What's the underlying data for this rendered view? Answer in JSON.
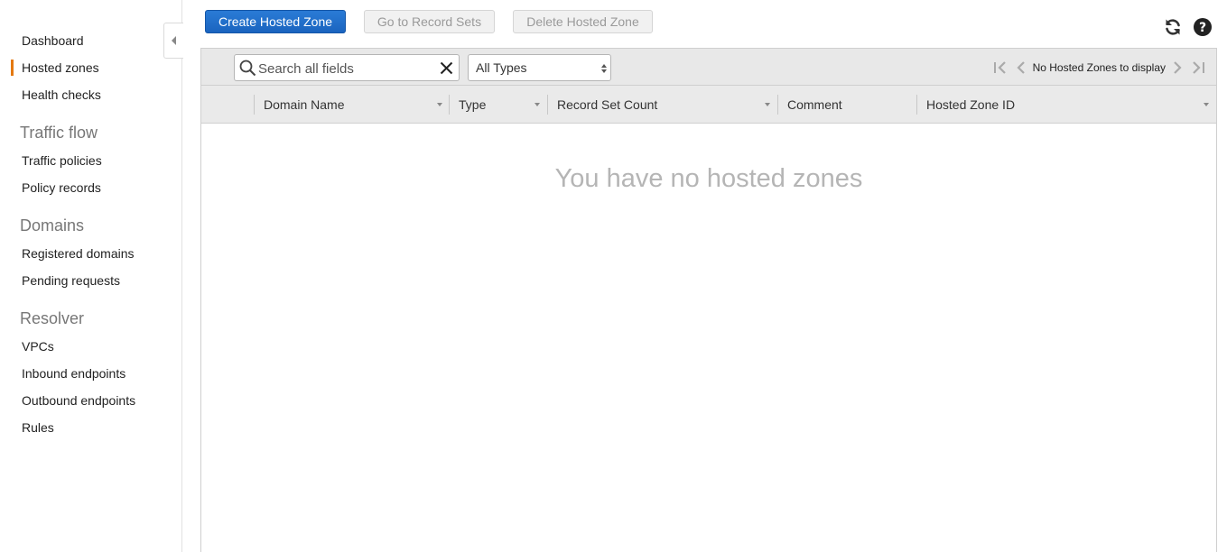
{
  "sidebar": {
    "items": [
      {
        "label": "Dashboard"
      },
      {
        "label": "Hosted zones",
        "active": true
      },
      {
        "label": "Health checks"
      }
    ],
    "sections": [
      {
        "title": "Traffic flow",
        "items": [
          "Traffic policies",
          "Policy records"
        ]
      },
      {
        "title": "Domains",
        "items": [
          "Registered domains",
          "Pending requests"
        ]
      },
      {
        "title": "Resolver",
        "items": [
          "VPCs",
          "Inbound endpoints",
          "Outbound endpoints",
          "Rules"
        ]
      }
    ]
  },
  "toolbar": {
    "create_label": "Create Hosted Zone",
    "goto_label": "Go to Record Sets",
    "delete_label": "Delete Hosted Zone"
  },
  "filter": {
    "search_placeholder": "Search all fields",
    "type_selected": "All Types"
  },
  "pager": {
    "status_label": "No Hosted Zones to display"
  },
  "table": {
    "columns": [
      "Domain Name",
      "Type",
      "Record Set Count",
      "Comment",
      "Hosted Zone ID"
    ]
  },
  "empty_message": "You have no hosted zones",
  "colors": {
    "primary_button": "#1a64bf",
    "active_indicator": "#e47911"
  },
  "icons": [
    "collapse-arrow-icon",
    "refresh-icon",
    "help-icon",
    "search-icon",
    "clear-icon",
    "first-page-icon",
    "prev-page-icon",
    "next-page-icon",
    "last-page-icon"
  ]
}
